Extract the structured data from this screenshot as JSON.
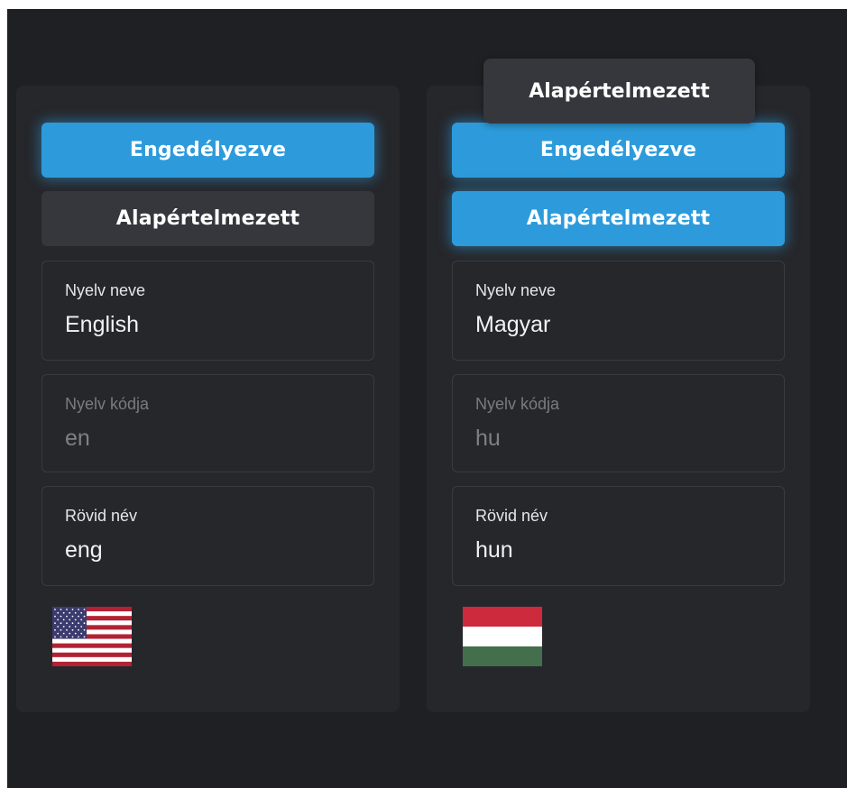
{
  "tooltip": {
    "text": "Alapértelmezett"
  },
  "languages": [
    {
      "enabled_label": "Engedélyezve",
      "enabled": true,
      "default_label": "Alapértelmezett",
      "is_default": false,
      "name_label": "Nyelv neve",
      "name_value": "English",
      "code_label": "Nyelv kódja",
      "code_value": "en",
      "short_label": "Rövid név",
      "short_value": "eng",
      "flag": "us-flag-icon"
    },
    {
      "enabled_label": "Engedélyezve",
      "enabled": true,
      "default_label": "Alapértelmezett",
      "is_default": true,
      "name_label": "Nyelv neve",
      "name_value": "Magyar",
      "code_label": "Nyelv kódja",
      "code_value": "hu",
      "short_label": "Rövid név",
      "short_value": "hun",
      "flag": "hu-flag-icon"
    }
  ],
  "colors": {
    "background": "#1f2023",
    "card": "#26272b",
    "accent": "#2d9bdb",
    "inactive_button": "#36373d"
  }
}
